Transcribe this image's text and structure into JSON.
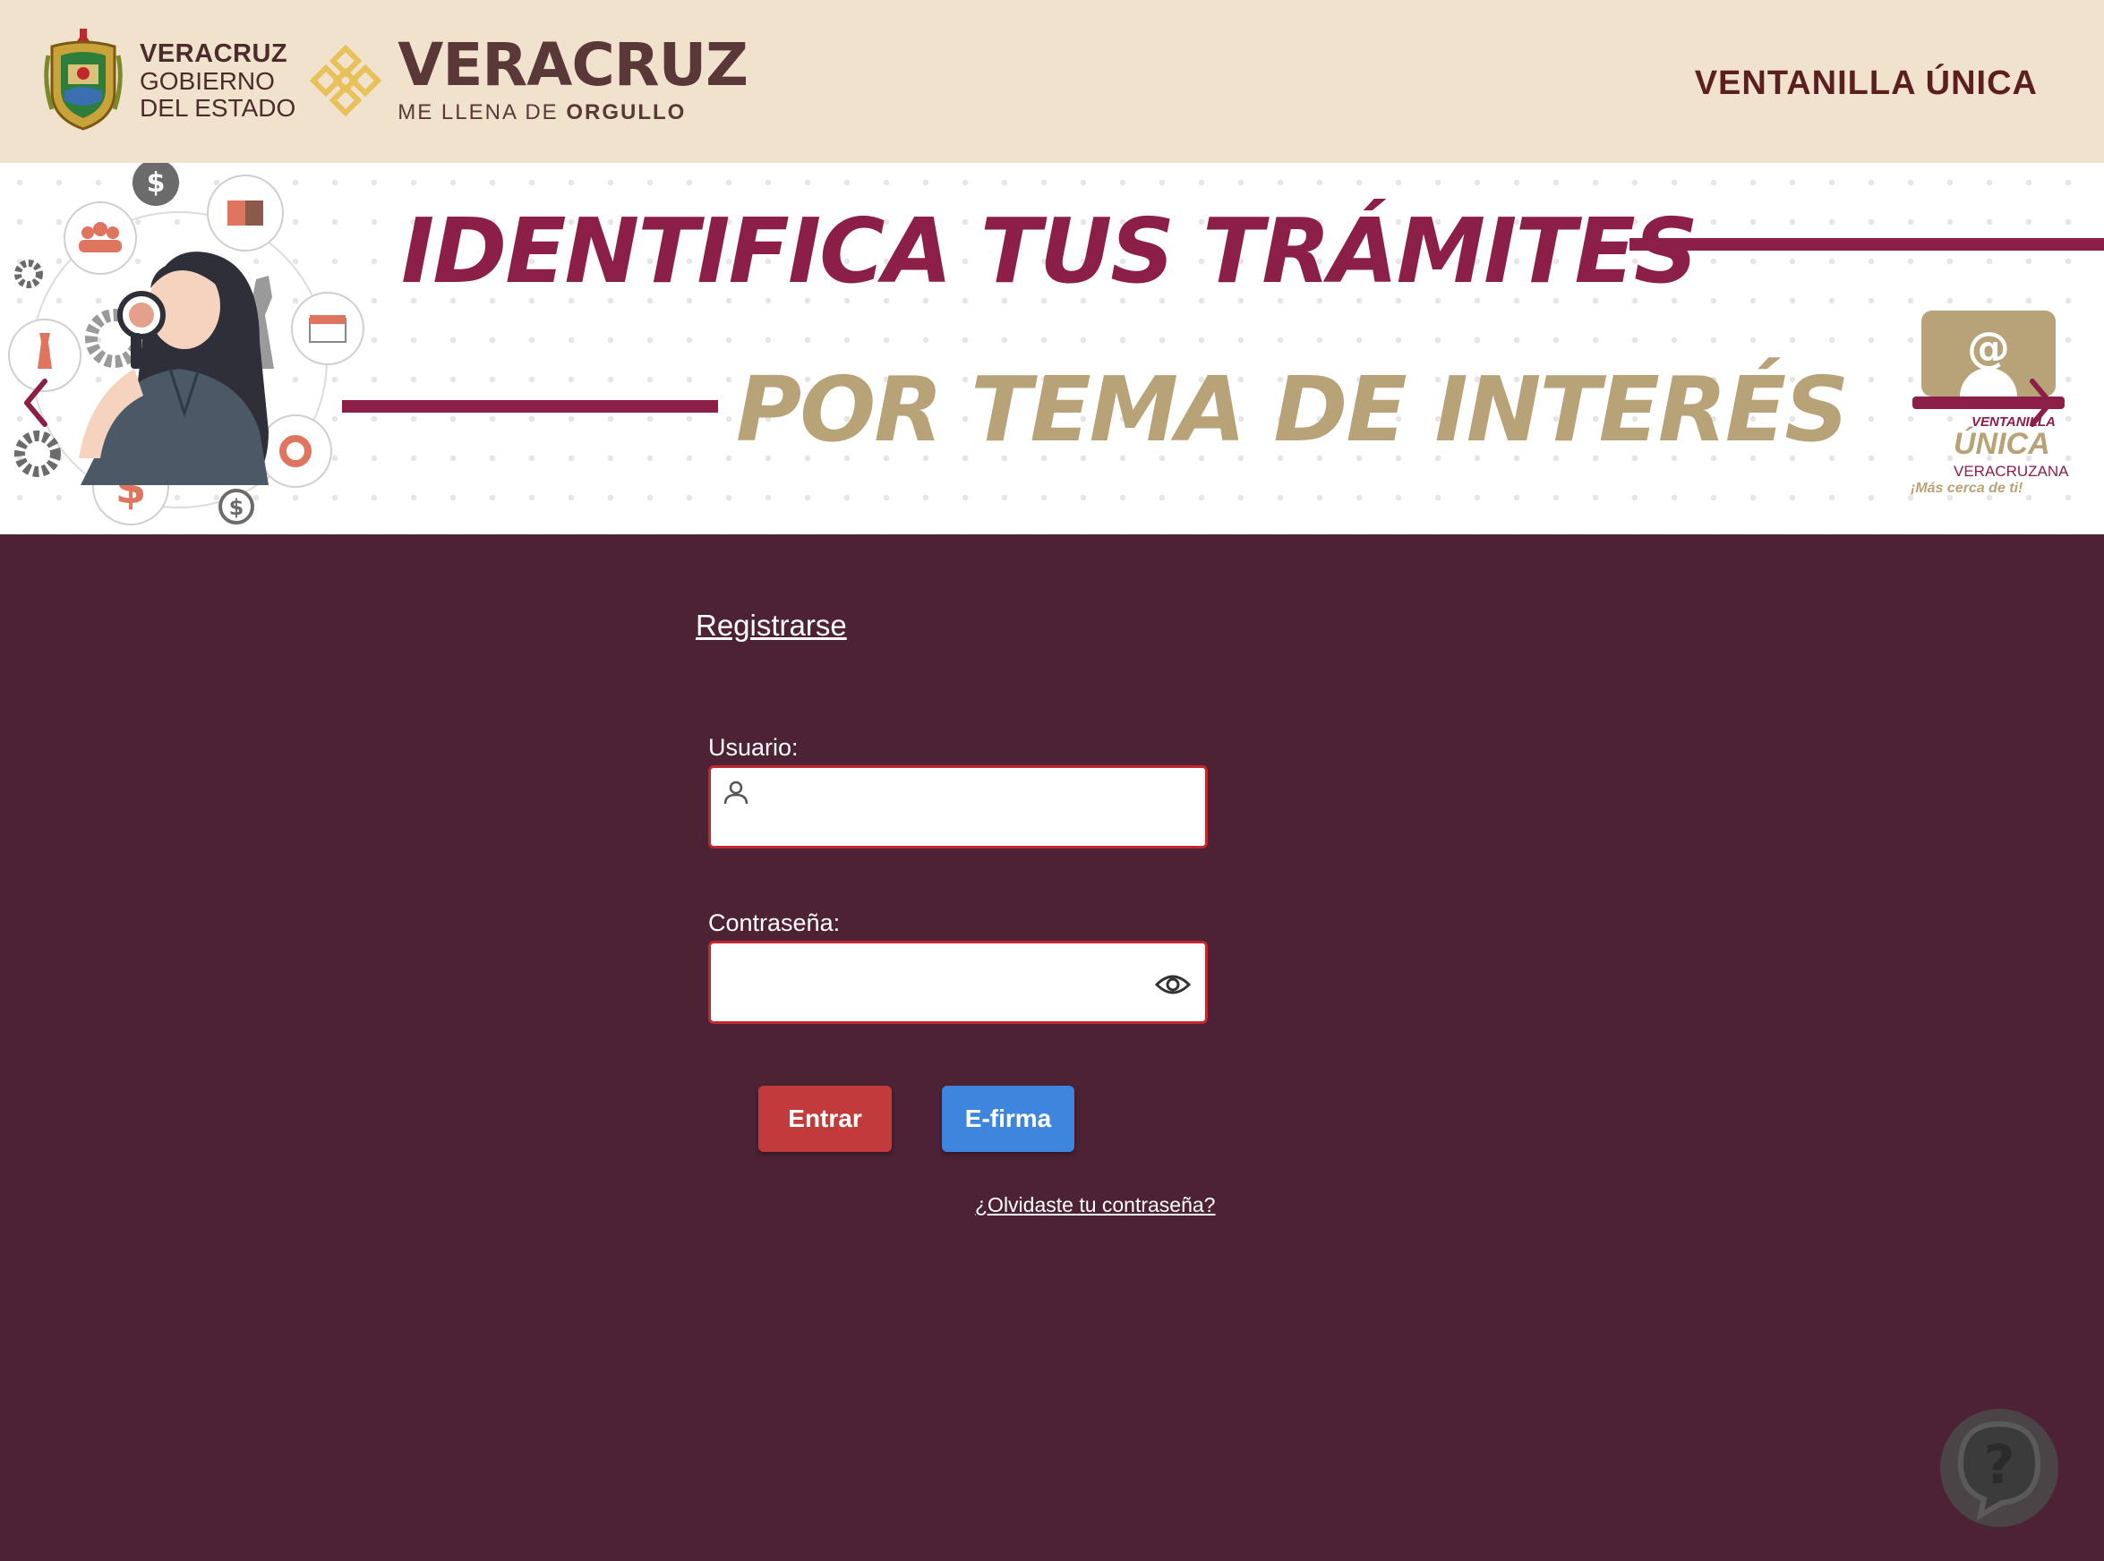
{
  "header": {
    "gov_line1": "VERACRUZ",
    "gov_line2": "GOBIERNO",
    "gov_line3": "DEL ESTADO",
    "brand_main": "VERACRUZ",
    "brand_tagline_prefix": "ME LLENA DE ",
    "brand_tagline_bold": "ORGULLO",
    "title": "VENTANILLA ÚNICA"
  },
  "banner": {
    "headline_line1": "IDENTIFICA TUS TRÁMITES",
    "headline_line2": "POR TEMA DE INTERÉS",
    "logo_top": "VENTANILLA",
    "logo_main": "ÚNICA",
    "logo_sub": "VERACRUZANA",
    "logo_slogan": "¡Más cerca de ti!",
    "logo_at": "@",
    "colors": {
      "maroon": "#8b1f47",
      "gold": "#b8a278"
    }
  },
  "form": {
    "register_label": "Registrarse",
    "user_label": "Usuario:",
    "user_value": "",
    "password_label": "Contraseña:",
    "password_value": "",
    "enter_label": "Entrar",
    "efirma_label": "E-firma",
    "forgot_label": "¿Olvidaste tu contraseña?"
  },
  "help": {
    "icon_glyph": "?"
  },
  "theme": {
    "page_bg": "#4d2235",
    "header_bg": "#f0e2cc",
    "enter_button": "#c23b3b",
    "efirma_button": "#3e86dd",
    "input_border": "#c1272d"
  }
}
